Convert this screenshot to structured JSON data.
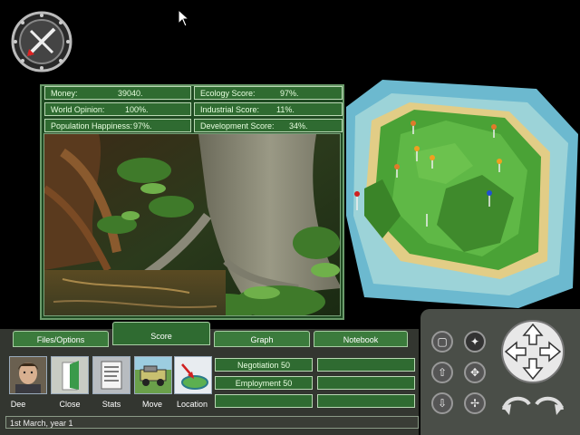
{
  "stats": {
    "money_label": "Money:",
    "money_value": "39040.",
    "world_opinion_label": "World Opinion:",
    "world_opinion_value": "100%.",
    "population_happiness_label": "Population Happiness:",
    "population_happiness_value": "97%.",
    "ecology_label": "Ecology Score:",
    "ecology_value": "97%.",
    "industrial_label": "Industrial Score:",
    "industrial_value": "11%.",
    "development_label": "Development Score:",
    "development_value": "34%."
  },
  "tabs": [
    {
      "label": "Files/Options"
    },
    {
      "label": "Score"
    },
    {
      "label": "Graph"
    },
    {
      "label": "Notebook"
    }
  ],
  "actions": [
    {
      "label": "Dee",
      "icon": "portrait-icon"
    },
    {
      "label": "Close",
      "icon": "door-icon"
    },
    {
      "label": "Stats",
      "icon": "document-icon"
    },
    {
      "label": "Move",
      "icon": "jeep-icon"
    },
    {
      "label": "Location",
      "icon": "island-arrow-icon"
    }
  ],
  "fields": {
    "negotiation": "Negotiation 50",
    "employment": "Employment 50"
  },
  "status": "1st March, year 1",
  "colors": {
    "panel_green": "#2f6b31",
    "border_light": "#b9d8b4",
    "ocean": "#5fb7c7",
    "sand": "#e3cf8a",
    "grass": "#4fa23a"
  }
}
